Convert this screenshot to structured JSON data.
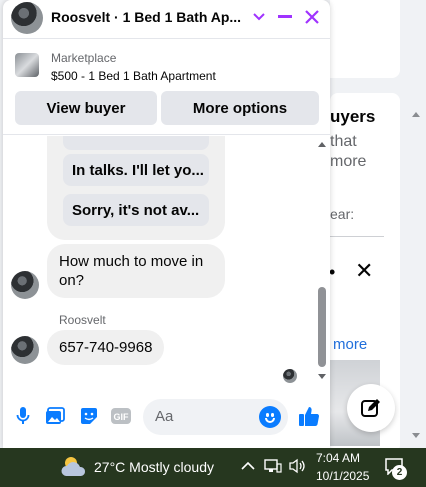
{
  "background": {
    "heading_fragment": "uyers",
    "line1_fragment": "that",
    "line2_fragment": "more",
    "line3_fragment": "ear:",
    "link_fragment": "more"
  },
  "chat": {
    "title": "Roosvelt · 1 Bed 1 Bath Ap...",
    "listing": {
      "label": "Marketplace",
      "title": "$500 - 1 Bed 1 Bath Apartment",
      "view_buyer_label": "View buyer",
      "more_options_label": "More options"
    },
    "quick_replies": [
      "In talks. I'll let yo...",
      "Sorry, it's not av..."
    ],
    "messages": [
      {
        "text": "How much to move in on?"
      },
      {
        "sender": "Roosvelt",
        "text": "657-740-9968"
      }
    ],
    "composer": {
      "placeholder": "Aa"
    }
  },
  "taskbar": {
    "weather": "27°C  Mostly cloudy",
    "time": "7:04 AM",
    "date": "10/1/2025",
    "notification_count": "2"
  },
  "colors": {
    "accent": "#a033ff",
    "messenger_blue": "#0a7cff",
    "taskbar": "#26371f"
  }
}
